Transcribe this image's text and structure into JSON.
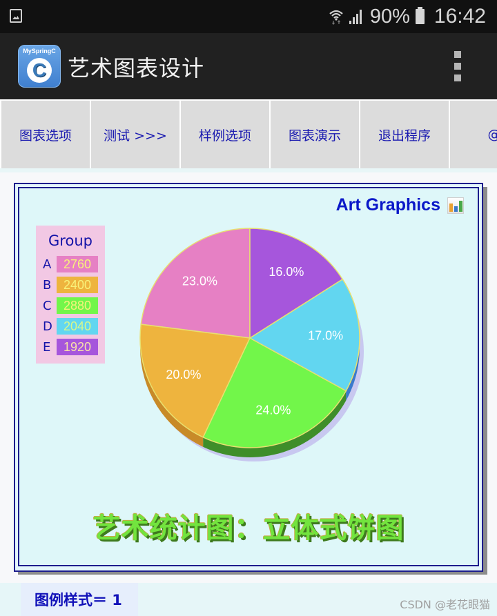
{
  "status_bar": {
    "battery_percent": "90%",
    "time": "16:42",
    "icons": [
      "gallery-icon",
      "wifi-icon",
      "signal-icon",
      "battery-icon"
    ]
  },
  "app_bar": {
    "logo_text": "MySpringC",
    "logo_letter": "C",
    "title": "艺术图表设计",
    "menu_icon": "overflow-menu-icon"
  },
  "nav": {
    "buttons": [
      {
        "label": "图表选项"
      },
      {
        "label": "测试 >>>"
      },
      {
        "label": "样例选项"
      },
      {
        "label": "图表演示"
      },
      {
        "label": "退出程序"
      },
      {
        "label": "@"
      }
    ]
  },
  "panel": {
    "heading": "Art Graphics",
    "heading_icon": "bar-chart-icon",
    "caption": "艺术统计图：立体式饼图"
  },
  "chart_data": {
    "type": "pie",
    "style": "3d",
    "title": "Art Graphics",
    "subtitle": "艺术统计图：立体式饼图",
    "legend_title": "Group",
    "legend_position": "top-left",
    "start_angle": "12 o'clock",
    "direction": "counterclockwise from A",
    "categories": [
      "A",
      "B",
      "C",
      "D",
      "E"
    ],
    "values": [
      2760,
      2400,
      2880,
      2040,
      1920
    ],
    "percent_labels": [
      "23.0%",
      "20.0%",
      "24.0%",
      "17.0%",
      "16.0%"
    ],
    "colors": [
      "#e680c4",
      "#eeb43e",
      "#72f64a",
      "#62d6f0",
      "#a656dc"
    ],
    "side_colors": [
      "#b85e98",
      "#c88a28",
      "#3f8e2a",
      "#3a7acc",
      "#7a3aaa"
    ],
    "legend_value_colors": [
      "#f8f27a",
      "#f8f27a",
      "#f8f27a",
      "#d8f88a",
      "#f8e2a8"
    ]
  },
  "footer": {
    "legend_style": "图例样式＝ 1",
    "watermark": "CSDN @老花眼猫"
  }
}
